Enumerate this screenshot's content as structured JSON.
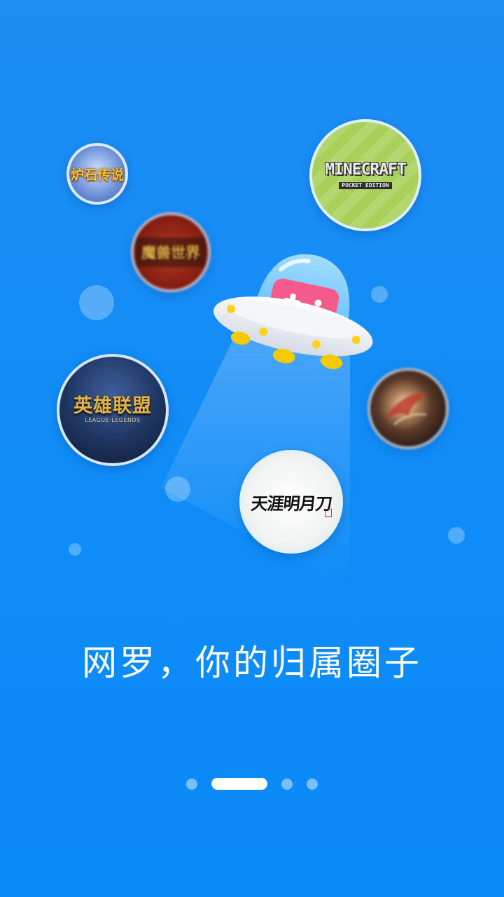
{
  "games": [
    {
      "name": "hearthstone",
      "title": "炉石传说"
    },
    {
      "name": "minecraft",
      "title": "MINECRAFT",
      "subtitle": "POCKET EDITION"
    },
    {
      "name": "world-of-warcraft",
      "title": "魔兽世界"
    },
    {
      "name": "league-of-legends",
      "title": "英雄联盟",
      "subtitle": "LEAGUE·LEGENDS"
    },
    {
      "name": "dragon-nest",
      "title": "",
      "subtitle": ""
    },
    {
      "name": "tianya-mingyue-dao",
      "title": "天涯明月刀"
    }
  ],
  "tagline": "网罗，你的归属圈子",
  "pager": {
    "count": 4,
    "active_index": 1
  },
  "colors": {
    "background": "#1a8ef6",
    "ufo_body": "#eef1f6",
    "ufo_dome": "#8fd3ff",
    "gamepad": "#f45b8c",
    "lights": "#ffd21a"
  },
  "icons": {
    "mascot": "ufo-gamepad-icon"
  }
}
